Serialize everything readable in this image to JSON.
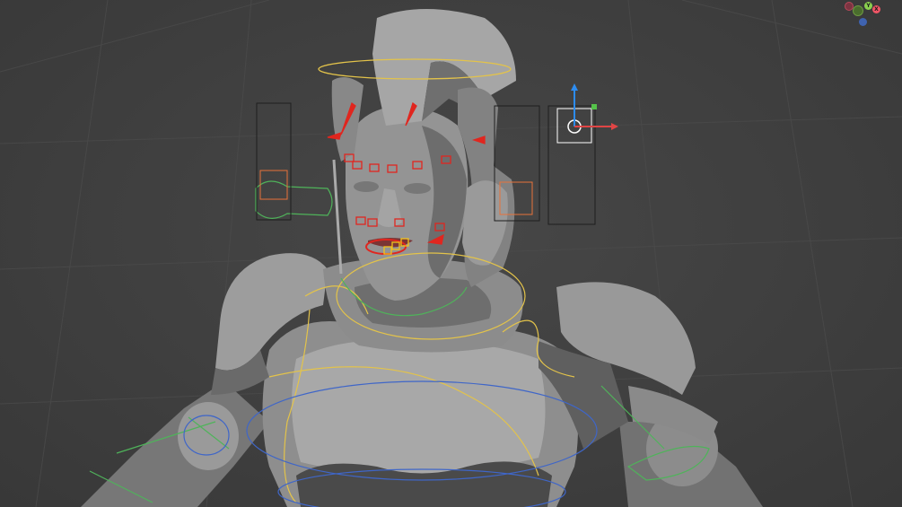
{
  "viewport": {
    "background": "#3f3f3f",
    "grid_color": "#4a4a4a"
  },
  "model": {
    "body_color": "#8f8f8f",
    "shadow_color": "#5e5e5e",
    "highlight_color": "#b2b2b2"
  },
  "rig": {
    "facial_control_color": "#e0261f",
    "selected_control_color": "#f2c21b",
    "fk_control_color": "#e3c34a",
    "ik_control_color": "#4fb35a",
    "spine_control_color": "#3f66c8",
    "slider_frame_color": "#1e1e1e",
    "slider_knob_color": "#e8723a"
  },
  "transform_gizmo": {
    "x_axis_color": "#e04545",
    "y_axis_color": "#2d8cf0",
    "center_color": "#ffffff",
    "corner_color": "#55c24a"
  },
  "navigation_gizmo": {
    "axes": [
      {
        "id": "neg-x",
        "label": "",
        "color": "#b8485a"
      },
      {
        "id": "neg-y",
        "label": "",
        "color": "#6e9a42"
      },
      {
        "id": "pos-y",
        "label": "Y",
        "color": "#8ad04f"
      },
      {
        "id": "pos-x",
        "label": "X",
        "color": "#f05566"
      },
      {
        "id": "neg-z",
        "label": "",
        "color": "#3f63b0"
      }
    ]
  }
}
